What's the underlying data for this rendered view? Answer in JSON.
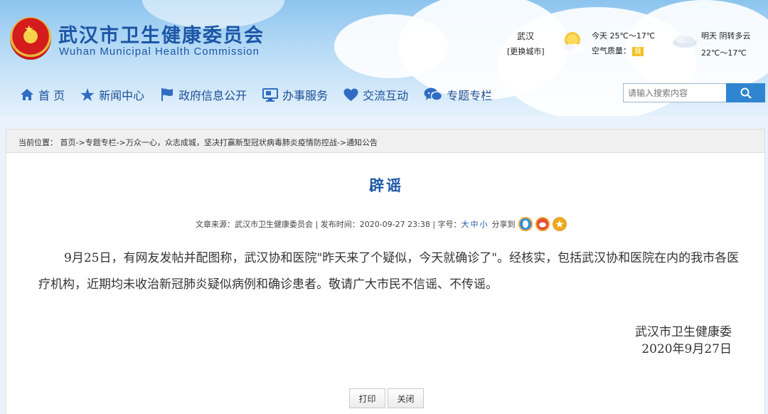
{
  "header": {
    "site_name_cn": "武汉市卫生健康委员会",
    "site_name_en": "Wuhan Municipal Health Commission"
  },
  "weather": {
    "city": "武汉",
    "change_city": "[更换城市]",
    "today": "今天  25℃～17℃",
    "air_quality_label": "空气质量：",
    "air_quality_value": "良",
    "tomorrow": "明天  阴转多云",
    "tomorrow_temp": "22℃～17℃"
  },
  "nav": {
    "items": [
      {
        "label": "首 页",
        "icon": "home-icon"
      },
      {
        "label": "新闻中心",
        "icon": "star-icon"
      },
      {
        "label": "政府信息公开",
        "icon": "flag-icon"
      },
      {
        "label": "办事服务",
        "icon": "monitor-icon"
      },
      {
        "label": "交流互动",
        "icon": "heart-icon"
      },
      {
        "label": "专题专栏",
        "icon": "chat-icon"
      }
    ]
  },
  "search": {
    "placeholder": "请输入搜索内容"
  },
  "breadcrumb": {
    "prefix": "当前位置：",
    "items": [
      "首页",
      "专题专栏",
      "万众一心，众志成城，坚决打赢新型冠状病毒肺炎疫情防控战",
      "通知公告"
    ],
    "separator": "->"
  },
  "article": {
    "title": "辟谣",
    "source_label": "文章来源：",
    "source": "武汉市卫生健康委员会",
    "date_label": "发布时间：",
    "date": "2020-09-27 23:38",
    "font_label": "字号：",
    "font_sizes": [
      "大",
      "中",
      "小"
    ],
    "share_label": "分享到",
    "body": "9月25日，有网友发帖并配图称，武汉协和医院\"昨天来了个疑似，今天就确诊了\"。经核实，包括武汉协和医院在内的我市各医疗机构，近期均未收治新冠肺炎疑似病例和确诊患者。敬请广大市民不信谣、不传谣。",
    "signature": "武汉市卫生健康委",
    "sign_date": "2020年9月27日",
    "print_label": "打印",
    "close_label": "关闭"
  },
  "colors": {
    "brand_blue": "#1d56a6",
    "search_button": "#2f85d0",
    "aq_good": "#f3c125"
  }
}
